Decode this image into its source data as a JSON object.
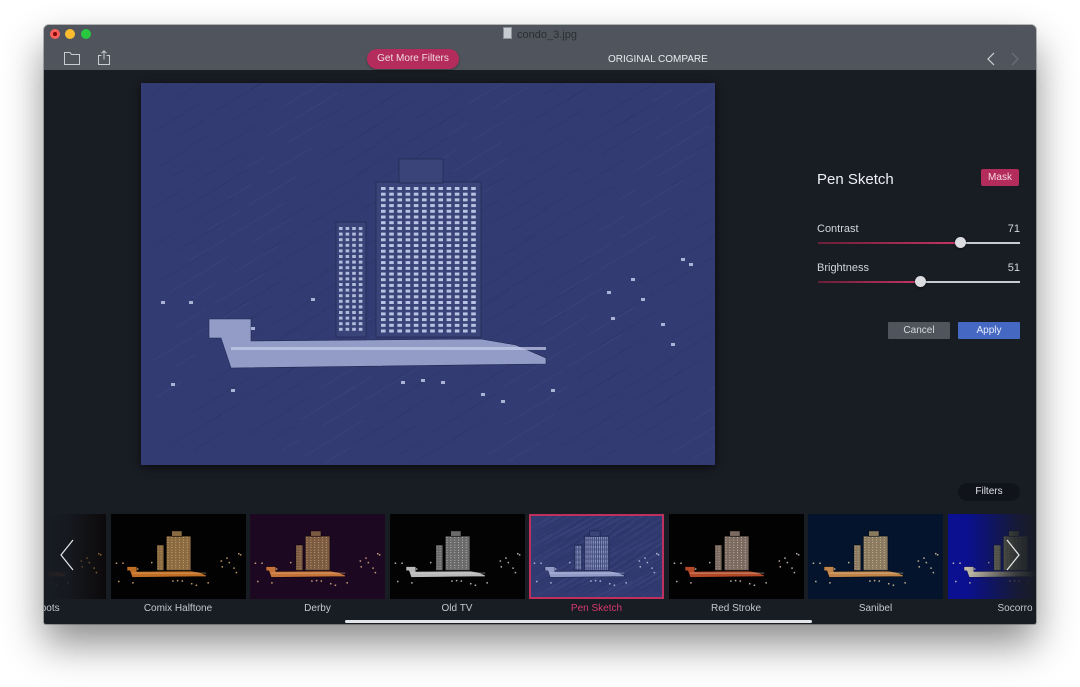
{
  "window": {
    "title": "condo_3.jpg",
    "file_icon": "document-icon"
  },
  "toolbar": {
    "open_icon": "folder-icon",
    "share_icon": "share-icon",
    "get_more_filters_label": "Get More Filters",
    "original_label": "ORIGINAL",
    "compare_label": "COMPARE",
    "prev_icon": "chevron-left-icon",
    "next_icon": "chevron-right-icon"
  },
  "preview": {
    "description": "Photo of a high-rise condo building at night rendered with Pen Sketch filter",
    "filter": "Pen Sketch"
  },
  "panel": {
    "title": "Pen Sketch",
    "mask_label": "Mask",
    "sliders": [
      {
        "label": "Contrast",
        "value": "71",
        "fraction": 0.71
      },
      {
        "label": "Brightness",
        "value": "51",
        "fraction": 0.51
      }
    ],
    "cancel_label": "Cancel",
    "apply_label": "Apply"
  },
  "filters_button_label": "Filters",
  "filter_strip": {
    "items": [
      {
        "label": "ght Spots",
        "style": "highlight"
      },
      {
        "label": "Comix Halftone",
        "style": "comix"
      },
      {
        "label": "Derby",
        "style": "derby"
      },
      {
        "label": "Old TV",
        "style": "oldtv"
      },
      {
        "label": "Pen Sketch",
        "style": "pensketch",
        "selected": true
      },
      {
        "label": "Red Stroke",
        "style": "redstroke"
      },
      {
        "label": "Sanibel",
        "style": "sanibel"
      },
      {
        "label": "Socorro",
        "style": "socorro"
      }
    ],
    "prev_icon": "chevron-left-icon",
    "next_icon": "chevron-right-icon"
  },
  "colors": {
    "accent": "#b42c5b",
    "selected_label": "#d63a6f",
    "apply": "#4568c3",
    "titlebar": "#50555d",
    "background": "#181c23",
    "preview_tint": "#333c72"
  }
}
